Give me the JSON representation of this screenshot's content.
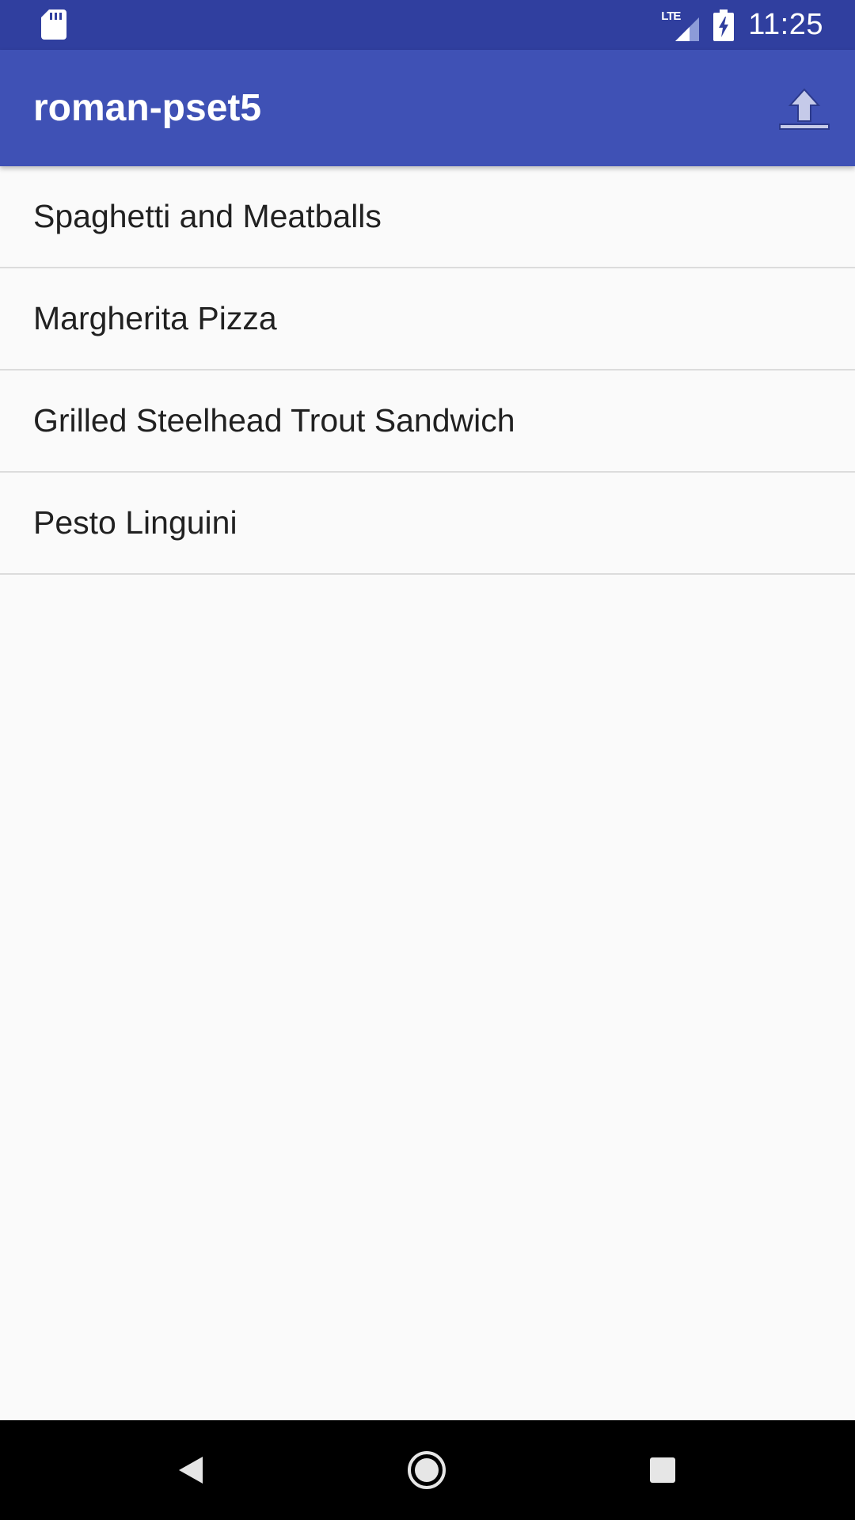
{
  "status_bar": {
    "time": "11:25",
    "network_label": "LTE",
    "icons": [
      "sd-card-icon",
      "lte-signal-icon",
      "battery-charging-icon"
    ],
    "background_color": "#303f9f"
  },
  "app_bar": {
    "title": "roman-pset5",
    "action_icon": "upload-icon",
    "background_color": "#3f51b5"
  },
  "list": {
    "items": [
      {
        "label": "Spaghetti and Meatballs"
      },
      {
        "label": "Margherita Pizza"
      },
      {
        "label": "Grilled Steelhead Trout Sandwich"
      },
      {
        "label": "Pesto Linguini"
      }
    ]
  },
  "nav_bar": {
    "buttons": [
      "back-icon",
      "home-icon",
      "recents-icon"
    ]
  }
}
